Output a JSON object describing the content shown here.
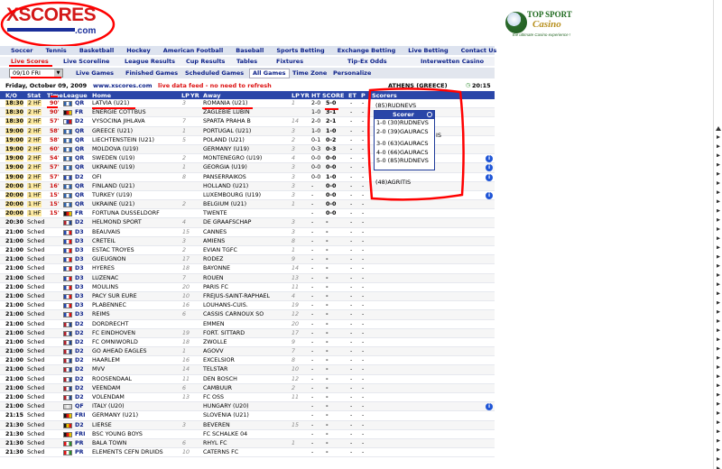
{
  "logo": {
    "text": "XSCORES",
    "domain": ".com"
  },
  "ad": {
    "line1": "TOP SPORT",
    "line2": "Casino",
    "tagline": "the ultimate Casino experience !"
  },
  "nav1": [
    "Soccer",
    "Tennis",
    "Basketball",
    "Hockey",
    "American Football",
    "Baseball",
    "Sports Betting",
    "Exchange Betting",
    "Live Betting",
    "Contact Us"
  ],
  "nav2": [
    "Live Scores",
    "Live Scoreline",
    "League Results",
    "Cup Results",
    "Tables",
    "Fixtures",
    "Tip-Ex Odds",
    "Interwetten Casino"
  ],
  "tabs": {
    "date_select": "09/10 FRI",
    "items": [
      "Live Games",
      "Finished Games",
      "Scheduled Games",
      "All Games",
      "Time Zone",
      "Personalize"
    ],
    "active": "All Games"
  },
  "info": {
    "date": "Friday, October 09, 2009",
    "site": "www.xscores.com",
    "notice": "live data feed - no need to refresh",
    "location": "ATHENS (GREECE)",
    "time": "20:15"
  },
  "header": {
    "ko": "K/O",
    "stat": "Stat",
    "time": "Time",
    "league": "League",
    "home": "Home",
    "lp": "LP",
    "yr": "YR",
    "away": "Away",
    "lp2": "LP",
    "yr2": "YR",
    "ht": "HT",
    "score": "SCORE",
    "et": "ET",
    "pen": "P",
    "scorers": "Scorers"
  },
  "flag_colors": {
    "red": "#d11",
    "white": "#fff",
    "blue": "#2244aa",
    "yellow": "#e6c200",
    "green": "#2a8a2a",
    "black": "#111",
    "orange": "#f08020"
  },
  "rows": [
    {
      "ko": "18:30",
      "st": "2 HF",
      "mn": "90'",
      "fl": [
        "#2b5fa8",
        "#ffffff",
        "#2b5fa8"
      ],
      "lg": "QR",
      "hm": "LATVIA (U21)",
      "hp": "3",
      "aw": "ROMANIA (U21)",
      "ap": "1",
      "hs": "2-0",
      "sc": "5-0",
      "live": true
    },
    {
      "ko": "18:30",
      "st": "2 HF",
      "mn": "90'",
      "fl": [
        "#111",
        "#d11",
        "#e6c200"
      ],
      "lg": "FR",
      "hm": "ENERGIE COTTBUS",
      "hp": "",
      "aw": "ZAGLEBIE LUBIN",
      "ap": "",
      "hs": "1-0",
      "sc": "3-1",
      "live": true
    },
    {
      "ko": "18:30",
      "st": "2 HF",
      "mn": "57'",
      "fl": [
        "#fff",
        "#2244aa",
        "#d11"
      ],
      "lg": "D2",
      "hm": "VYSOCINA JIHLAVA",
      "hp": "7",
      "aw": "SPARTA PRAHA B",
      "ap": "14",
      "hs": "2-0",
      "sc": "2-1",
      "live": true
    },
    {
      "ko": "19:00",
      "st": "2 HF",
      "mn": "58'",
      "fl": [
        "#2b5fa8",
        "#fff",
        "#2b5fa8"
      ],
      "lg": "QR",
      "hm": "GREECE (U21)",
      "hp": "1",
      "aw": "PORTUGAL (U21)",
      "ap": "3",
      "hs": "1-0",
      "sc": "1-0",
      "live": true
    },
    {
      "ko": "19:00",
      "st": "2 HF",
      "mn": "58'",
      "fl": [
        "#2b5fa8",
        "#fff",
        "#2b5fa8"
      ],
      "lg": "QR",
      "hm": "LIECHTENSTEIN (U21)",
      "hp": "5",
      "aw": "POLAND (U21)",
      "ap": "2",
      "hs": "0-1",
      "sc": "0-2",
      "live": true
    },
    {
      "ko": "19:00",
      "st": "2 HF",
      "mn": "60'",
      "fl": [
        "#2b5fa8",
        "#fff",
        "#2b5fa8"
      ],
      "lg": "QR",
      "hm": "MOLDOVA (U19)",
      "hp": "",
      "aw": "GERMANY (U19)",
      "ap": "3",
      "hs": "0-3",
      "sc": "0-3",
      "live": true
    },
    {
      "ko": "19:00",
      "st": "2 HF",
      "mn": "54'",
      "fl": [
        "#2b5fa8",
        "#fff",
        "#2b5fa8"
      ],
      "lg": "QR",
      "hm": "SWEDEN (U19)",
      "hp": "2",
      "aw": "MONTENEGRO (U19)",
      "ap": "4",
      "hs": "0-0",
      "sc": "0-0",
      "live": true,
      "info": true
    },
    {
      "ko": "19:00",
      "st": "2 HF",
      "mn": "57'",
      "fl": [
        "#2b5fa8",
        "#fff",
        "#2b5fa8"
      ],
      "lg": "QR",
      "hm": "UKRAINE (U19)",
      "hp": "1",
      "aw": "GEORGIA (U19)",
      "ap": "3",
      "hs": "0-0",
      "sc": "0-0",
      "live": true,
      "info": true
    },
    {
      "ko": "19:00",
      "st": "2 HF",
      "mn": "57'",
      "fl": [
        "#2244aa",
        "#fff",
        "#2244aa"
      ],
      "lg": "D2",
      "hm": "OFI",
      "hp": "8",
      "aw": "PANSERRAIKOS",
      "ap": "3",
      "hs": "0-0",
      "sc": "1-0",
      "live": true,
      "info": true
    },
    {
      "ko": "20:00",
      "st": "1 HF",
      "mn": "16'",
      "fl": [
        "#2b5fa8",
        "#fff",
        "#2b5fa8"
      ],
      "lg": "QR",
      "hm": "FINLAND (U21)",
      "hp": "",
      "aw": "HOLLAND (U21)",
      "ap": "3",
      "hs": "-",
      "sc": "0-0",
      "live": true
    },
    {
      "ko": "20:00",
      "st": "1 HF",
      "mn": "15'",
      "fl": [
        "#2b5fa8",
        "#fff",
        "#2b5fa8"
      ],
      "lg": "QR",
      "hm": "TURKEY (U19)",
      "hp": "",
      "aw": "LUXEMBOURG (U19)",
      "ap": "3",
      "hs": "-",
      "sc": "0-0",
      "live": true,
      "info": true
    },
    {
      "ko": "20:00",
      "st": "1 HF",
      "mn": "15'",
      "fl": [
        "#2b5fa8",
        "#fff",
        "#2b5fa8"
      ],
      "lg": "QR",
      "hm": "UKRAINE (U21)",
      "hp": "2",
      "aw": "BELGIUM (U21)",
      "ap": "1",
      "hs": "-",
      "sc": "0-0",
      "live": true
    },
    {
      "ko": "20:00",
      "st": "1 HF",
      "mn": "15'",
      "fl": [
        "#111",
        "#d11",
        "#e6c200"
      ],
      "lg": "FR",
      "hm": "FORTUNA DUSSELDORF",
      "hp": "",
      "aw": "TWENTE",
      "ap": "",
      "hs": "-",
      "sc": "0-0",
      "live": true
    },
    {
      "ko": "20:30",
      "st": "Sched",
      "mn": "",
      "fl": [
        "#ae1c28",
        "#fff",
        "#21468b"
      ],
      "lg": "D2",
      "hm": "HELMOND SPORT",
      "hp": "4",
      "aw": "DE GRAAFSCHAP",
      "ap": "3",
      "hs": "-",
      "sc": "-"
    },
    {
      "ko": "21:00",
      "st": "Sched",
      "mn": "",
      "fl": [
        "#2244aa",
        "#fff",
        "#d11"
      ],
      "lg": "D3",
      "hm": "BEAUVAIS",
      "hp": "15",
      "aw": "CANNES",
      "ap": "3",
      "hs": "-",
      "sc": "-"
    },
    {
      "ko": "21:00",
      "st": "Sched",
      "mn": "",
      "fl": [
        "#2244aa",
        "#fff",
        "#d11"
      ],
      "lg": "D3",
      "hm": "CRETEIL",
      "hp": "3",
      "aw": "AMIENS",
      "ap": "8",
      "hs": "-",
      "sc": "-"
    },
    {
      "ko": "21:00",
      "st": "Sched",
      "mn": "",
      "fl": [
        "#2244aa",
        "#fff",
        "#d11"
      ],
      "lg": "D3",
      "hm": "ESTAC TROYES",
      "hp": "2",
      "aw": "EVIAN TGFC",
      "ap": "1",
      "hs": "-",
      "sc": "-"
    },
    {
      "ko": "21:00",
      "st": "Sched",
      "mn": "",
      "fl": [
        "#2244aa",
        "#fff",
        "#d11"
      ],
      "lg": "D3",
      "hm": "GUEUGNON",
      "hp": "17",
      "aw": "RODEZ",
      "ap": "9",
      "hs": "-",
      "sc": "-"
    },
    {
      "ko": "21:00",
      "st": "Sched",
      "mn": "",
      "fl": [
        "#2244aa",
        "#fff",
        "#d11"
      ],
      "lg": "D3",
      "hm": "HYERES",
      "hp": "18",
      "aw": "BAYONNE",
      "ap": "14",
      "hs": "-",
      "sc": "-"
    },
    {
      "ko": "21:00",
      "st": "Sched",
      "mn": "",
      "fl": [
        "#2244aa",
        "#fff",
        "#d11"
      ],
      "lg": "D3",
      "hm": "LUZENAC",
      "hp": "7",
      "aw": "ROUEN",
      "ap": "13",
      "hs": "-",
      "sc": "-"
    },
    {
      "ko": "21:00",
      "st": "Sched",
      "mn": "",
      "fl": [
        "#2244aa",
        "#fff",
        "#d11"
      ],
      "lg": "D3",
      "hm": "MOULINS",
      "hp": "20",
      "aw": "PARIS FC",
      "ap": "11",
      "hs": "-",
      "sc": "-"
    },
    {
      "ko": "21:00",
      "st": "Sched",
      "mn": "",
      "fl": [
        "#2244aa",
        "#fff",
        "#d11"
      ],
      "lg": "D3",
      "hm": "PACY SUR EURE",
      "hp": "10",
      "aw": "FREJUS-SAINT-RAPHAEL",
      "ap": "4",
      "hs": "-",
      "sc": "-"
    },
    {
      "ko": "21:00",
      "st": "Sched",
      "mn": "",
      "fl": [
        "#2244aa",
        "#fff",
        "#d11"
      ],
      "lg": "D3",
      "hm": "PLABENNEC",
      "hp": "16",
      "aw": "LOUHANS-CUIS.",
      "ap": "19",
      "hs": "-",
      "sc": "-"
    },
    {
      "ko": "21:00",
      "st": "Sched",
      "mn": "",
      "fl": [
        "#2244aa",
        "#fff",
        "#d11"
      ],
      "lg": "D3",
      "hm": "REIMS",
      "hp": "6",
      "aw": "CASSIS CARNOUX SO",
      "ap": "12",
      "hs": "-",
      "sc": "-"
    },
    {
      "ko": "21:00",
      "st": "Sched",
      "mn": "",
      "fl": [
        "#ae1c28",
        "#fff",
        "#21468b"
      ],
      "lg": "D2",
      "hm": "DORDRECHT",
      "hp": "",
      "aw": "EMMEN",
      "ap": "20",
      "hs": "-",
      "sc": "-"
    },
    {
      "ko": "21:00",
      "st": "Sched",
      "mn": "",
      "fl": [
        "#ae1c28",
        "#fff",
        "#21468b"
      ],
      "lg": "D2",
      "hm": "FC EINDHOVEN",
      "hp": "19",
      "aw": "FORT. SITTARD",
      "ap": "17",
      "hs": "-",
      "sc": "-"
    },
    {
      "ko": "21:00",
      "st": "Sched",
      "mn": "",
      "fl": [
        "#ae1c28",
        "#fff",
        "#21468b"
      ],
      "lg": "D2",
      "hm": "FC OMNIWORLD",
      "hp": "18",
      "aw": "ZWOLLE",
      "ap": "9",
      "hs": "-",
      "sc": "-"
    },
    {
      "ko": "21:00",
      "st": "Sched",
      "mn": "",
      "fl": [
        "#ae1c28",
        "#fff",
        "#21468b"
      ],
      "lg": "D2",
      "hm": "GO AHEAD EAGLES",
      "hp": "1",
      "aw": "AGOVV",
      "ap": "7",
      "hs": "-",
      "sc": "-"
    },
    {
      "ko": "21:00",
      "st": "Sched",
      "mn": "",
      "fl": [
        "#ae1c28",
        "#fff",
        "#21468b"
      ],
      "lg": "D2",
      "hm": "HAARLEM",
      "hp": "16",
      "aw": "EXCELSIOR",
      "ap": "8",
      "hs": "-",
      "sc": "-"
    },
    {
      "ko": "21:00",
      "st": "Sched",
      "mn": "",
      "fl": [
        "#ae1c28",
        "#fff",
        "#21468b"
      ],
      "lg": "D2",
      "hm": "MVV",
      "hp": "14",
      "aw": "TELSTAR",
      "ap": "10",
      "hs": "-",
      "sc": "-"
    },
    {
      "ko": "21:00",
      "st": "Sched",
      "mn": "",
      "fl": [
        "#ae1c28",
        "#fff",
        "#21468b"
      ],
      "lg": "D2",
      "hm": "ROOSENDAAL",
      "hp": "11",
      "aw": "DEN BOSCH",
      "ap": "12",
      "hs": "-",
      "sc": "-"
    },
    {
      "ko": "21:00",
      "st": "Sched",
      "mn": "",
      "fl": [
        "#ae1c28",
        "#fff",
        "#21468b"
      ],
      "lg": "D2",
      "hm": "VEENDAM",
      "hp": "6",
      "aw": "CAMBUUR",
      "ap": "2",
      "hs": "-",
      "sc": "-"
    },
    {
      "ko": "21:00",
      "st": "Sched",
      "mn": "",
      "fl": [
        "#ae1c28",
        "#fff",
        "#21468b"
      ],
      "lg": "D2",
      "hm": "VOLENDAM",
      "hp": "13",
      "aw": "FC OSS",
      "ap": "11",
      "hs": "-",
      "sc": "-"
    },
    {
      "ko": "21:00",
      "st": "Sched",
      "mn": "",
      "fl": [
        "#ccc",
        "#eee",
        "#ccc"
      ],
      "lg": "QF",
      "hm": "ITALY (U20)",
      "hp": "",
      "aw": "HUNGARY (U20)",
      "ap": "",
      "hs": "-",
      "sc": "-",
      "info": true
    },
    {
      "ko": "21:15",
      "st": "Sched",
      "mn": "",
      "fl": [
        "#111",
        "#d11",
        "#e6c200"
      ],
      "lg": "FRI",
      "hm": "GERMANY (U21)",
      "hp": "",
      "aw": "SLOVENIA (U21)",
      "ap": "",
      "hs": "-",
      "sc": "-"
    },
    {
      "ko": "21:30",
      "st": "Sched",
      "mn": "",
      "fl": [
        "#111",
        "#e6c200",
        "#d11"
      ],
      "lg": "D2",
      "hm": "LIERSE",
      "hp": "3",
      "aw": "BEVEREN",
      "ap": "15",
      "hs": "-",
      "sc": "-"
    },
    {
      "ko": "21:30",
      "st": "Sched",
      "mn": "",
      "fl": [
        "#111",
        "#d11",
        "#e6c200"
      ],
      "lg": "FRI",
      "hm": "BSC YOUNG BOYS",
      "hp": "",
      "aw": "FC SCHALKE 04",
      "ap": "",
      "hs": "-",
      "sc": "-"
    },
    {
      "ko": "21:30",
      "st": "Sched",
      "mn": "",
      "fl": [
        "#d11",
        "#fff",
        "#2a8a2a"
      ],
      "lg": "PR",
      "hm": "BALA TOWN",
      "hp": "6",
      "aw": "RHYL FC",
      "ap": "1",
      "hs": "-",
      "sc": "-"
    },
    {
      "ko": "21:30",
      "st": "Sched",
      "mn": "",
      "fl": [
        "#d11",
        "#fff",
        "#2a8a2a"
      ],
      "lg": "PR",
      "hm": "ELEMENTS CEFN DRUIDS",
      "hp": "10",
      "aw": "CATERNS FC",
      "ap": "",
      "hs": "-",
      "sc": "-"
    }
  ],
  "scorers": {
    "row1": "(85)RUDNEVS",
    "row9": "(48)AGRITIS"
  },
  "popup": {
    "title": "Scorer",
    "items": [
      "1-0 (30)RUDNEVS",
      "2-0 (39)GAURACS",
      "3-0 (63)GAURACS",
      "4-0 (66)GAURACS",
      "5-0 (85)RUDNEVS"
    ],
    "trail": "IS"
  },
  "annotation_color": "#ff0000"
}
